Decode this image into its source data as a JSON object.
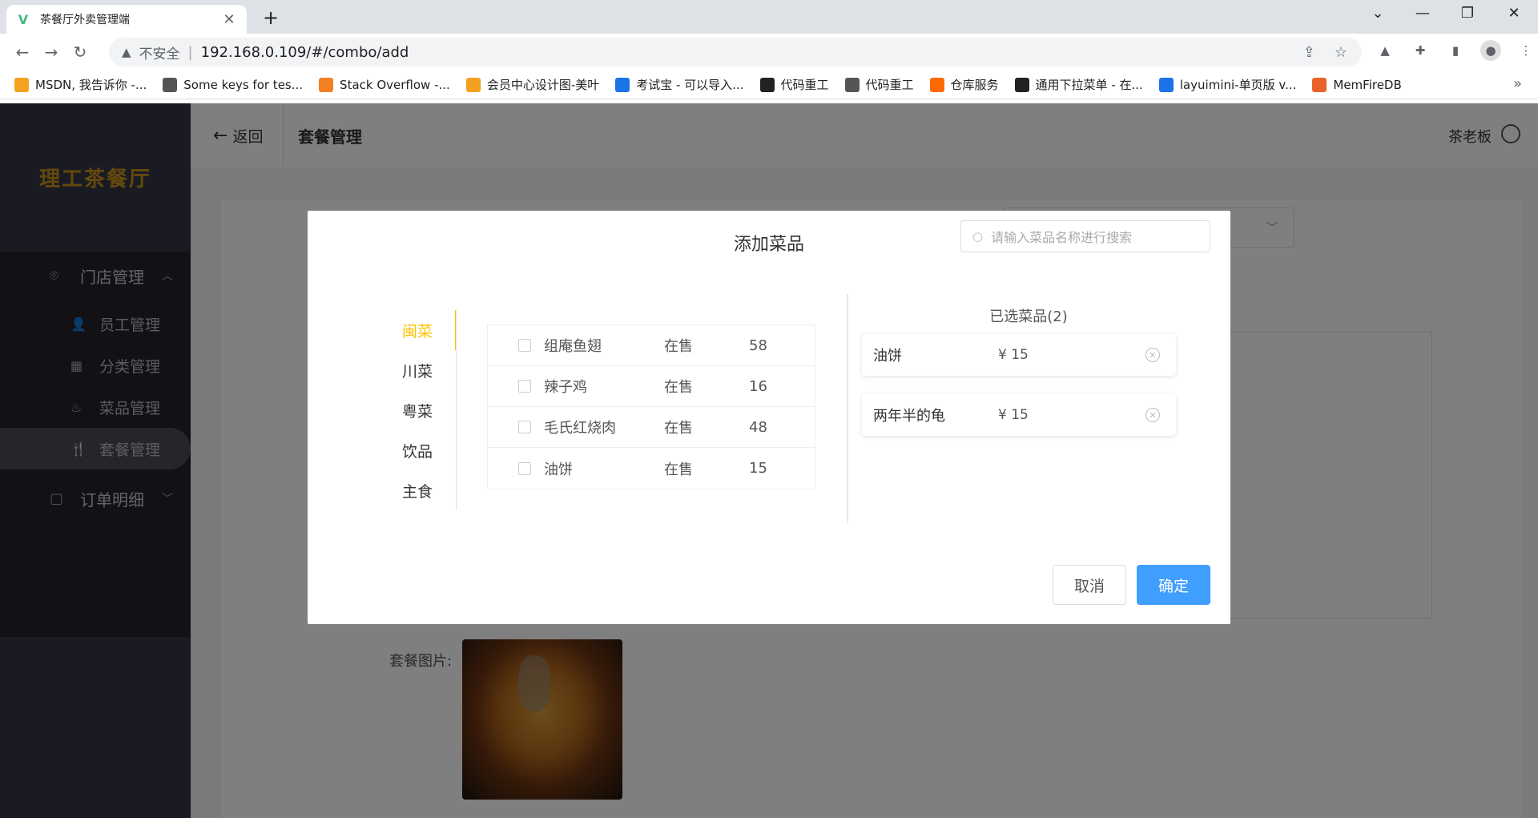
{
  "browser": {
    "tab_title": "茶餐厅外卖管理端",
    "tab_close": "✕",
    "new_tab": "+",
    "win_min": "—",
    "win_max": "❐",
    "win_close": "✕",
    "win_down": "⌄",
    "insecure_label": "不安全",
    "url": "192.168.0.109/#/combo/add",
    "bookmarks": [
      {
        "label": "MSDN, 我告诉你 -...",
        "color": "#f4a020"
      },
      {
        "label": "Some keys for tes...",
        "color": "#555"
      },
      {
        "label": "Stack Overflow -...",
        "color": "#f48024"
      },
      {
        "label": "会员中心设计图-美叶",
        "color": "#f4a020"
      },
      {
        "label": "考试宝 - 可以导入...",
        "color": "#1a73e8"
      },
      {
        "label": "代码重工",
        "color": "#222"
      },
      {
        "label": "代码重工",
        "color": "#555"
      },
      {
        "label": "仓库服务",
        "color": "#ff6a00"
      },
      {
        "label": "通用下拉菜单 - 在...",
        "color": "#222"
      },
      {
        "label": "layuimini-单页版 v...",
        "color": "#1a73e8"
      },
      {
        "label": "MemFireDB",
        "color": "#e8622a"
      }
    ],
    "bookmarks_more": "»"
  },
  "sidebar": {
    "logo": "理工茶餐厅",
    "store_menu": "门店管理",
    "items": [
      {
        "label": "员工管理",
        "icon": "👤"
      },
      {
        "label": "分类管理",
        "icon": "▦"
      },
      {
        "label": "菜品管理",
        "icon": "♨"
      },
      {
        "label": "套餐管理",
        "icon": "🍴"
      }
    ],
    "order_menu": "订单明细"
  },
  "header": {
    "back_label": "返回",
    "page_title": "套餐管理",
    "user": "茶老板"
  },
  "form": {
    "image_label": "套餐图片:"
  },
  "modal": {
    "title": "添加菜品",
    "search_placeholder": "请输入菜品名称进行搜索",
    "categories": [
      "闽菜",
      "川菜",
      "粤菜",
      "饮品",
      "主食"
    ],
    "active_category": "闽菜",
    "dishes": [
      {
        "name": "组庵鱼翅",
        "status": "在售",
        "price": "58"
      },
      {
        "name": "辣子鸡",
        "status": "在售",
        "price": "16"
      },
      {
        "name": "毛氏红烧肉",
        "status": "在售",
        "price": "48"
      },
      {
        "name": "油饼",
        "status": "在售",
        "price": "15"
      }
    ],
    "selected_title": "已选菜品(2)",
    "selected": [
      {
        "name": "油饼",
        "price": "¥ 15"
      },
      {
        "name": "两年半的龟",
        "price": "¥ 15"
      }
    ],
    "cancel": "取消",
    "confirm": "确定"
  }
}
